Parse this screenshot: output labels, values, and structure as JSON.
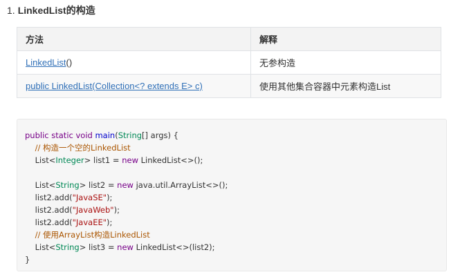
{
  "heading": {
    "number": "1.",
    "title": "LinkedList的构造"
  },
  "table": {
    "headers": [
      "方法",
      "解释"
    ],
    "rows": [
      {
        "method": "LinkedList",
        "method_suffix": "()",
        "description": "无参构造"
      },
      {
        "method": "public LinkedList(Collection<? extends E> c)",
        "method_suffix": "",
        "description": "使用其他集合容器中元素构造List"
      }
    ]
  },
  "code": {
    "language": "java",
    "lines": [
      "public static void main(String[] args) {",
      "    // 构造一个空的LinkedList",
      "    List<Integer> list1 = new LinkedList<>();",
      "",
      "    List<String> list2 = new java.util.ArrayList<>();",
      "    list2.add(\"JavaSE\");",
      "    list2.add(\"JavaWeb\");",
      "    list2.add(\"JavaEE\");",
      "    // 使用ArrayList构造LinkedList",
      "    List<String> list3 = new LinkedList<>(list2);",
      "}"
    ],
    "tokens": {
      "l1": {
        "kw1": "public static void",
        "fn": "main",
        "p1": "(",
        "ty": "String",
        "p2": "[] args) {"
      },
      "l2": {
        "indent": "    ",
        "comment": "// 构造一个空的LinkedList"
      },
      "l3": {
        "indent": "    ",
        "a": "List<",
        "ty": "Integer",
        "b": "> list1 = ",
        "kw": "new",
        "c": " LinkedList<>();"
      },
      "l5": {
        "indent": "    ",
        "a": "List<",
        "ty": "String",
        "b": "> list2 = ",
        "kw": "new",
        "c": " java.util.ArrayList<>();"
      },
      "l6": {
        "indent": "    ",
        "a": "list2.add(",
        "str": "\"JavaSE\"",
        "b": ");"
      },
      "l7": {
        "indent": "    ",
        "a": "list2.add(",
        "str": "\"JavaWeb\"",
        "b": ");"
      },
      "l8": {
        "indent": "    ",
        "a": "list2.add(",
        "str": "\"JavaEE\"",
        "b": ");"
      },
      "l9": {
        "indent": "    ",
        "comment": "// 使用ArrayList构造LinkedList"
      },
      "l10": {
        "indent": "    ",
        "a": "List<",
        "ty": "String",
        "b": "> list3 = ",
        "kw": "new",
        "c": " LinkedList<>(list2);"
      },
      "l11": {
        "a": "}"
      }
    }
  },
  "colors": {
    "keyword": "#770088",
    "function": "#0000cc",
    "type": "#008855",
    "string": "#aa1111",
    "comment": "#aa5500",
    "link": "#2f6fb7"
  }
}
